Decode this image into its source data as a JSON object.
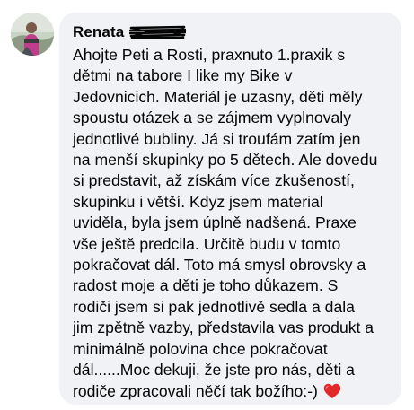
{
  "comment": {
    "author": "Renata",
    "lines": [
      "Ahojte Peti a Rosti, praxnuto 1.praxik s",
      "dětmi na tabore I like my Bike v",
      "Jedovnicich. Materiál je uzasny, děti měly",
      "spoustu otázek a se zájmem vyplnovaly",
      "jednotlivé bubliny. Já si troufám zatím jen",
      "na menší skupinky po 5 dětech. Ale dovedu",
      "si predstavit, až získám více zkušeností,",
      "skupinku i větší. Kdyz jsem material",
      "uviděla, byla jsem úplně nadšená. Praxe",
      "vše ještě predcila. Určitě budu v tomto",
      "pokračovat dál. Toto má smysl obrovsky a",
      "radost moje a děti je toho důkazem. S",
      "rodiči jsem si pak jednotlivě sedla a dala",
      "jim zpětně vazby, představila vas produkt a",
      "minimálně polovina chce pokračovat",
      "dál......Moc dekuji, že jste pro nás, děti a",
      "rodiče zpracovali něčí tak božího:-)"
    ],
    "emoji": "red-heart-icon",
    "colors": {
      "bubble": "#f0f2f5",
      "text": "#050505",
      "heart": "#e02a2a"
    }
  }
}
